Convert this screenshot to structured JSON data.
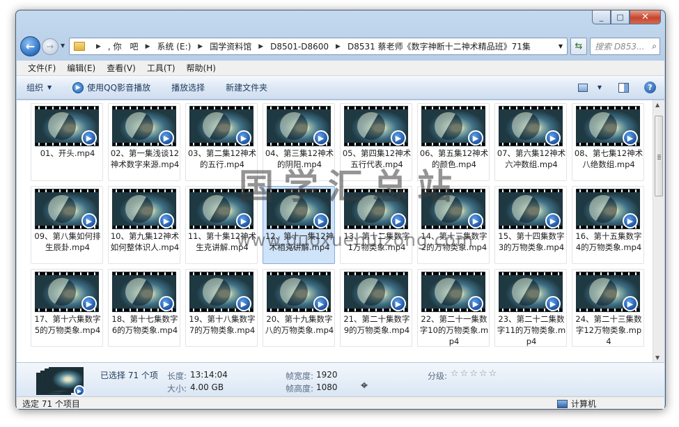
{
  "window": {
    "caption_buttons": {
      "minimize": "_",
      "maximize": "□",
      "close": "✕"
    }
  },
  "address": {
    "breadcrumbs": [
      ", 你　吧",
      "系统 (E:)",
      "国学资料馆",
      "D8501-D8600",
      "D8531 蔡老师《数字神断十二神术精品班》71集"
    ],
    "search_placeholder": "搜索 D853..."
  },
  "menu": [
    "文件(F)",
    "编辑(E)",
    "查看(V)",
    "工具(T)",
    "帮助(H)"
  ],
  "toolbar": {
    "organize": "组织",
    "play_qq": "使用QQ影音播放",
    "play_selection": "播放选择",
    "new_folder": "新建文件夹"
  },
  "files": [
    "01、开头.mp4",
    "02、第一集浅谈12神术数字来源.mp4",
    "03、第二集12神术的五行.mp4",
    "04、第三集12神术的阴阳.mp4",
    "05、第四集12神术五行代表.mp4",
    "06、第五集12神术的颜色.mp4",
    "07、第六集12神术六冲数组.mp4",
    "08、第七集12神术八绝数组.mp4",
    "09、第八集如何排生辰卦.mp4",
    "10、第九集12神术如何整体识人.mp4",
    "11、第十集12神术生克讲解.mp4",
    "12、第十一集12神术相克讲解.mp4",
    "13、第十二集数字1万物类象.mp4",
    "14、第十三集数字2的万物类象.mp4",
    "15、第十四集数字3的万物类象.mp4",
    "16、第十五集数字4的万物类象.mp4",
    "17、第十六集数字5的万物类象.mp4",
    "18、第十七集数字6的万物类象.mp4",
    "19、第十八集数字7的万物类象.mp4",
    "20、第十九集数字八的万物类象.mp4",
    "21、第二十集数字9的万物类象.mp4",
    "22、第二十一集数字10的万物类象.mp4",
    "23、第二十二集数字11的万物类象.mp4",
    "24、第二十三集数字12万物类象.mp4"
  ],
  "selected_index": 11,
  "watermark": {
    "title": "国学汇总站",
    "url": "www.guoxuehuizong.com"
  },
  "details": {
    "selected": "已选择 71 个项",
    "duration_label": "长度:",
    "duration_value": "13:14:04",
    "size_label": "大小:",
    "size_value": "4.00 GB",
    "frame_width_label": "帧宽度:",
    "frame_width_value": "1920",
    "frame_height_label": "帧高度:",
    "frame_height_value": "1080",
    "rating_label": "分级:",
    "rating_stars": "☆☆☆☆☆"
  },
  "status": {
    "left": "选定 71 个项目",
    "right": "计算机"
  },
  "colors": {
    "selection": "#cfe3f9",
    "toolbar": "#dde8f5",
    "close_button": "#c7442c"
  }
}
